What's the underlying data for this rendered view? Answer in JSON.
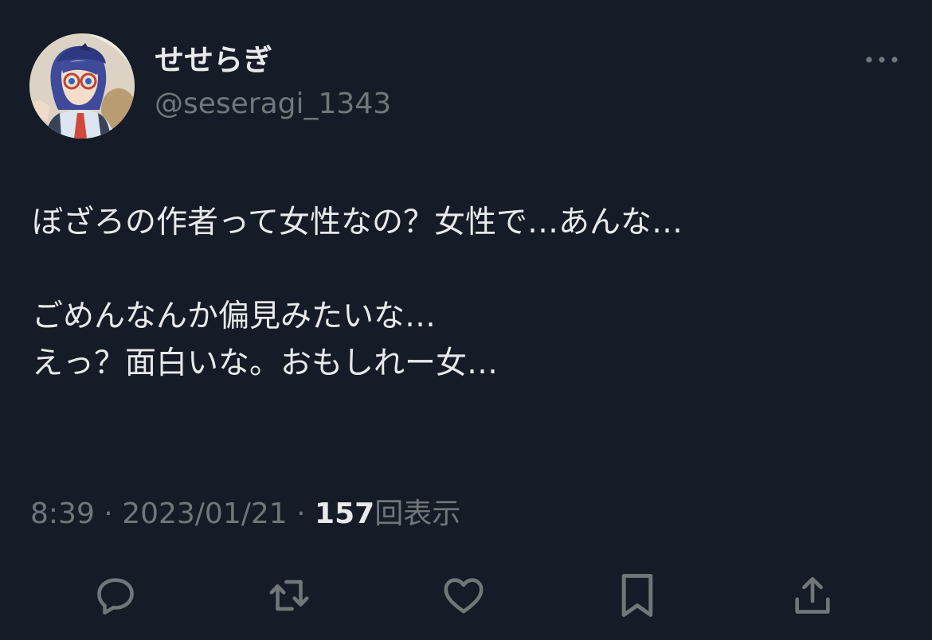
{
  "user": {
    "display_name": "せせらぎ",
    "handle": "@seseragi_1343"
  },
  "tweet": {
    "lines": [
      "ぼざろの作者って女性なの？女性で…あんな…",
      "",
      "ごめんなんか偏見みたいな…",
      "えっ？面白いな。おもしれー女…"
    ]
  },
  "meta": {
    "time": "8:39",
    "separator": " · ",
    "date": "2023/01/21",
    "views_count": "157",
    "views_label": "回表示"
  },
  "icons": {
    "more": "more-horizontal-icon",
    "reply": "reply-icon",
    "retweet": "retweet-icon",
    "like": "heart-icon",
    "bookmark": "bookmark-icon",
    "share": "share-icon"
  },
  "colors": {
    "background": "#161c27",
    "text_primary": "#e7e9ea",
    "text_secondary": "#71767b"
  }
}
